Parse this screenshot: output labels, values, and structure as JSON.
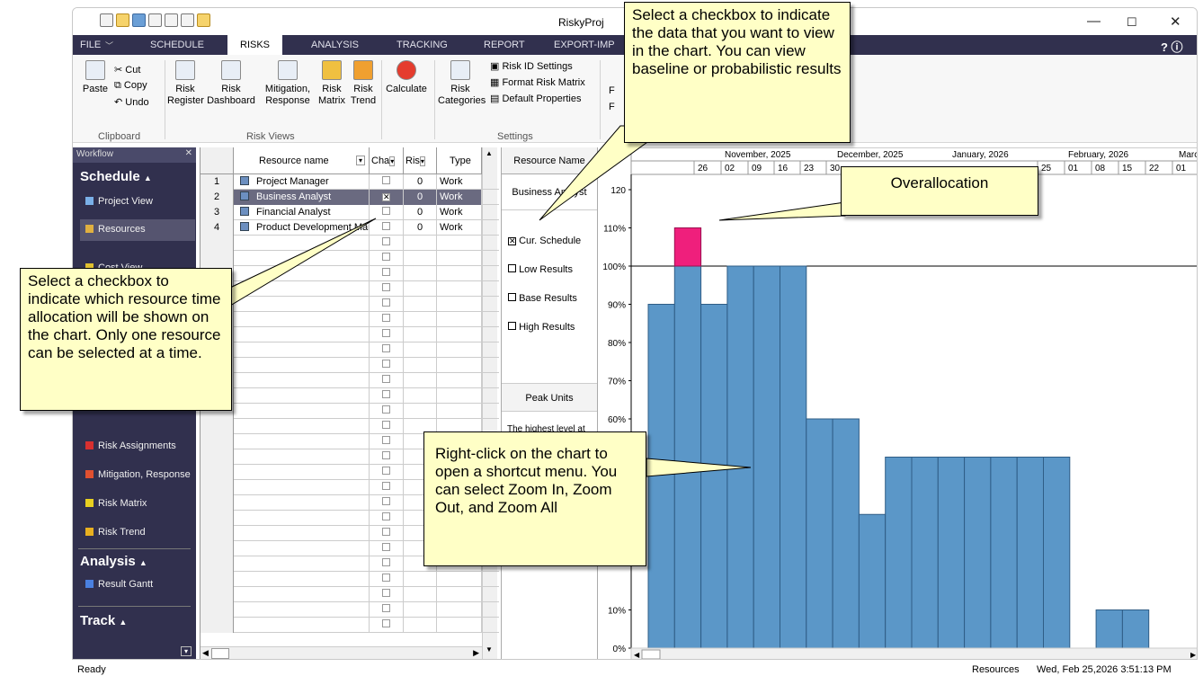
{
  "window": {
    "title": "RiskyProj",
    "min": "—",
    "max": "☐",
    "close": "✕"
  },
  "ribbon_tabs": [
    "FILE",
    "SCHEDULE",
    "RISKS",
    "ANALYSIS",
    "TRACKING",
    "REPORT",
    "EXPORT-IMP"
  ],
  "ribbon_right": "? ⓘ",
  "clipboard": {
    "paste": "Paste",
    "cut": "Cut",
    "copy": "Copy",
    "undo": "Undo",
    "group": "Clipboard"
  },
  "risk_views": {
    "b1": [
      "Risk",
      "Register"
    ],
    "b2": [
      "Risk",
      "Dashboard"
    ],
    "b3": [
      "Mitigation,",
      "Response"
    ],
    "b4": [
      "Risk",
      "Matrix"
    ],
    "b5": [
      "Risk",
      "Trend"
    ],
    "group": "Risk Views"
  },
  "calc": "Calculate",
  "settings": {
    "categories": [
      "Risk",
      "Categories"
    ],
    "id": "Risk ID Settings",
    "format": "Format Risk Matrix",
    "defaults": "Default Properties",
    "group": "Settings",
    "extra1": "F",
    "extra2": "F"
  },
  "workflow": {
    "header": "Workflow",
    "schedule": "Schedule",
    "items1": [
      "Project View",
      "Resources",
      "Cost View"
    ],
    "items2": [
      "Risk Assignments",
      "Mitigation, Response",
      "Risk Matrix",
      "Risk Trend"
    ],
    "analysis": "Analysis",
    "items3": [
      "Result Gantt"
    ],
    "track": "Track"
  },
  "grid": {
    "headers": [
      "Resource name",
      "Cha",
      "Ris",
      "Type"
    ],
    "rows": [
      {
        "n": "1",
        "name": "Project Manager",
        "risk": "0",
        "type": "Work"
      },
      {
        "n": "2",
        "name": "Business Analyst",
        "risk": "0",
        "type": "Work"
      },
      {
        "n": "3",
        "name": "Financial Analyst",
        "risk": "0",
        "type": "Work"
      },
      {
        "n": "4",
        "name": "Product Development Mar",
        "risk": "0",
        "type": "Work"
      }
    ]
  },
  "mid": {
    "header": "Resource Name",
    "selected": "Business Analyst",
    "opts": [
      "Cur. Schedule",
      "Low Results",
      "Base Results",
      "High Results"
    ],
    "peak": "Peak Units",
    "peak_desc": "The highest level at"
  },
  "chart_data": {
    "type": "bar",
    "months": [
      "November, 2025",
      "December, 2025",
      "January, 2026",
      "February, 2026",
      "Marc"
    ],
    "weeks": [
      "26",
      "02",
      "09",
      "16",
      "23",
      "30",
      "25",
      "01",
      "08",
      "15",
      "22",
      "01"
    ],
    "yticks": [
      "120",
      "110%",
      "100%",
      "90%",
      "80%",
      "70%",
      "60%",
      "10%",
      "0%"
    ],
    "values": [
      90,
      100,
      90,
      100,
      100,
      100,
      60,
      60,
      35,
      50,
      50,
      50,
      50,
      50,
      50,
      50,
      0,
      10,
      10
    ],
    "over": [
      0,
      10,
      0,
      0,
      0,
      0,
      0,
      0,
      0,
      0,
      0,
      0,
      0,
      0,
      0,
      0,
      0,
      0,
      0
    ],
    "ylim": [
      0,
      125
    ],
    "colors": {
      "bar": "#5b97c8",
      "over": "#ef1f7c"
    }
  },
  "callouts": {
    "c1": "Select a checkbox to indicate the data that you want to view in the chart. You can view baseline or probabilistic results",
    "c2": "Overallocation",
    "c3": "Select a checkbox to indicate which resource time allocation will be shown on the chart. Only one resource can be selected at a time.",
    "c4": "Right-click on the chart to open a shortcut menu. You can select Zoom In, Zoom Out, and Zoom All"
  },
  "status": {
    "left": "Ready",
    "view": "Resources",
    "time": "Wed, Feb 25,2026  3:51:13 PM"
  }
}
